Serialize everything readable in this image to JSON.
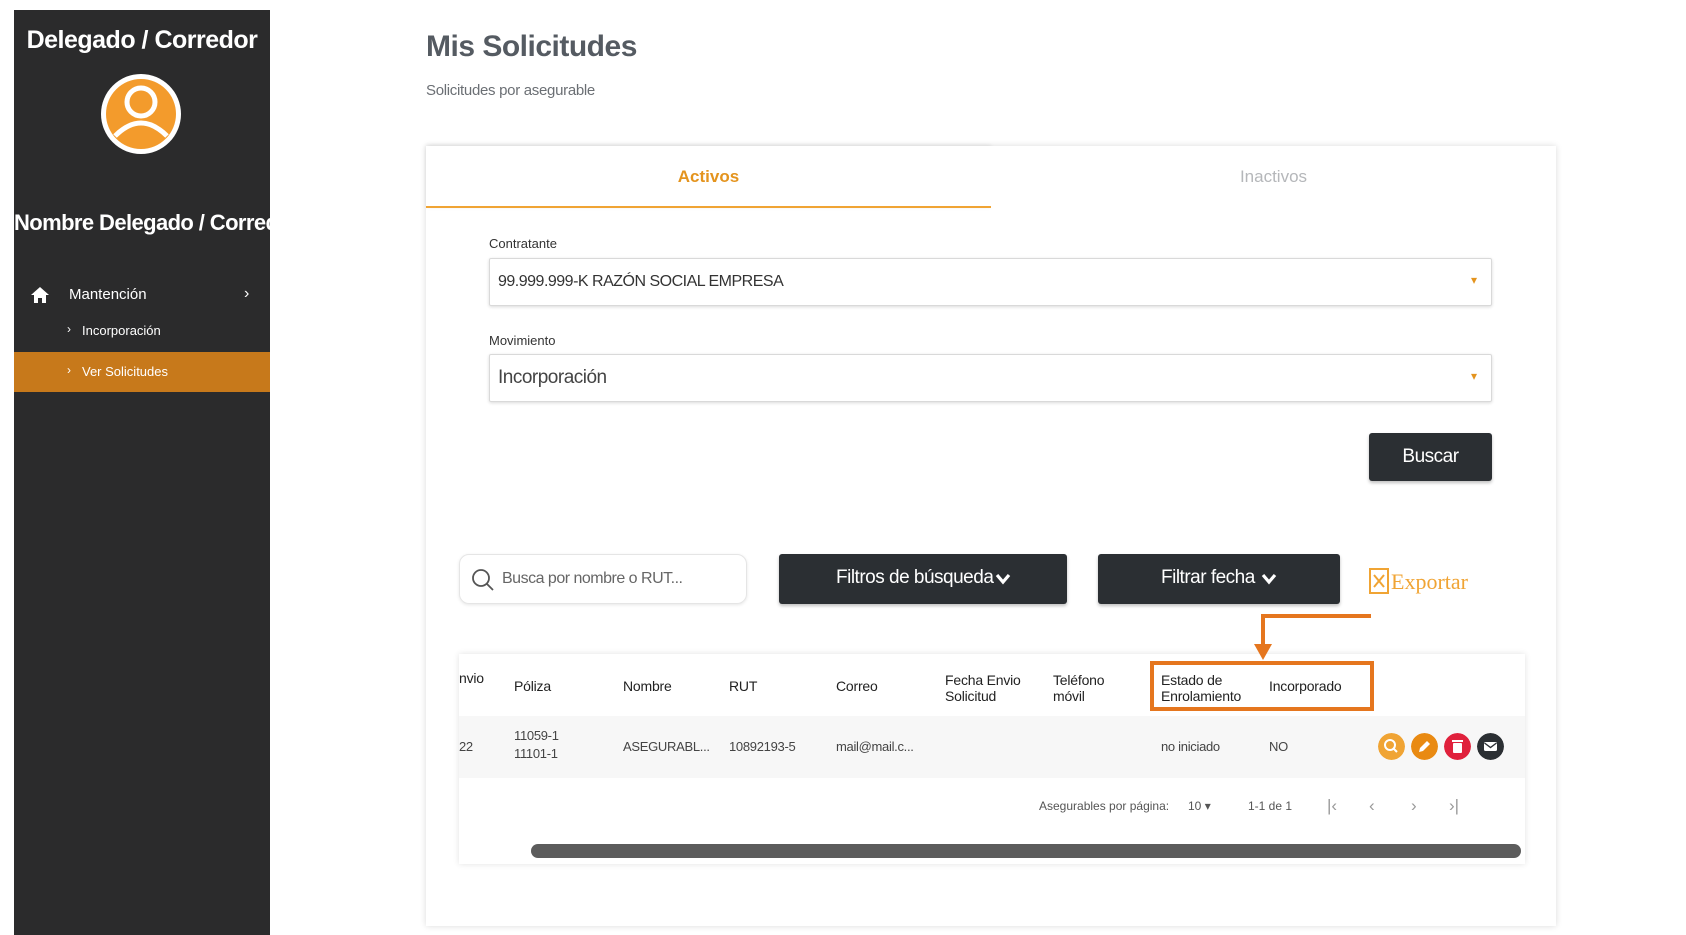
{
  "sidebar": {
    "role_title": "Delegado / Corredor",
    "user_name": "Nombre Delegado / Corredor",
    "menu": {
      "label": "Mantención",
      "chevron": "›"
    },
    "sub_items": [
      {
        "label": "Incorporación",
        "active": false
      },
      {
        "label": "Ver Solicitudes",
        "active": true
      }
    ],
    "accent": "#c7791b"
  },
  "header": {
    "title": "Mis Solicitudes",
    "subtitle": "Solicitudes por asegurable"
  },
  "tabs": [
    {
      "label": "Activos",
      "active": true
    },
    {
      "label": "Inactivos",
      "active": false
    }
  ],
  "form": {
    "contratante_label": "Contratante",
    "contratante_value": "99.999.999-K RAZÓN SOCIAL EMPRESA",
    "movimiento_label": "Movimiento",
    "movimiento_value": "Incorporación",
    "caret": "⌄",
    "buscar_label": "Buscar"
  },
  "toolbar": {
    "search_placeholder": "Busca por nombre o RUT...",
    "filtros_label": "Filtros de búsqueda",
    "fecha_label": "Filtrar fecha",
    "exportar_label": "Exportar"
  },
  "table": {
    "headers": {
      "envio": "nvio",
      "poliza": "Póliza",
      "nombre": "Nombre",
      "rut": "RUT",
      "correo": "Correo",
      "fecha_envio_1": "Fecha Envio",
      "fecha_envio_2": "Solicitud",
      "telefono_1": "Teléfono",
      "telefono_2": "móvil",
      "estado_1": "Estado de",
      "estado_2": "Enrolamiento",
      "incorporado": "Incorporado"
    },
    "rows": [
      {
        "envio": "22",
        "poliza_1": "11059-1",
        "poliza_2": "11101-1",
        "nombre": "ASEGURABL...",
        "rut": "10892193-5",
        "correo": "mail@mail.c...",
        "estado": "no iniciado",
        "incorporado": "NO"
      }
    ],
    "actions": [
      {
        "icon": "search-icon",
        "color": "#f0a434"
      },
      {
        "icon": "pencil-icon",
        "color": "#e98a12"
      },
      {
        "icon": "trash-icon",
        "color": "#e0213c"
      },
      {
        "icon": "mail-icon",
        "color": "#2b2f33"
      }
    ],
    "pager": {
      "per_page_label": "Asegurables por página:",
      "per_page_value": "10",
      "range": "1-1 de 1",
      "first": "|‹",
      "prev": "‹",
      "next": "›",
      "last": "›|"
    }
  },
  "colors": {
    "orange": "#f0a434",
    "annotation": "#e5761e",
    "dark": "#2b2f33"
  }
}
